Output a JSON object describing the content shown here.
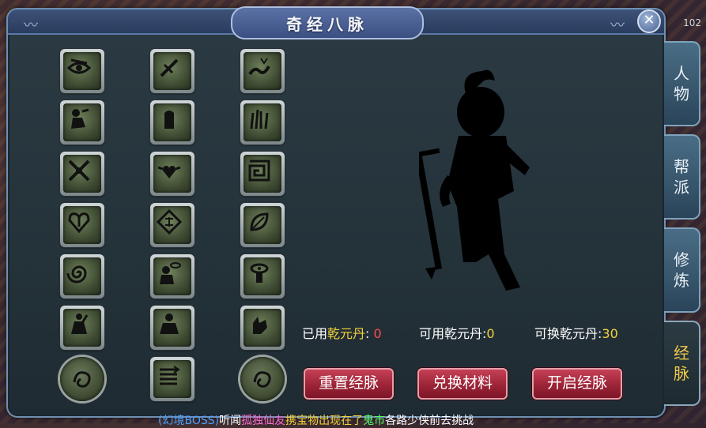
{
  "corner_number": "102",
  "window": {
    "title": "奇经八脉",
    "close_glyph": "✕"
  },
  "meridian_icons": {
    "column_1": [
      "eye-meridian",
      "figure-meridian",
      "crossed-blades-meridian",
      "heart-crest-meridian",
      "spiral-meridian",
      "warrior-meridian",
      "dragon-seal-meridian"
    ],
    "column_2": [
      "blade-strike-meridian",
      "stone-pillar-meridian",
      "winged-heart-meridian",
      "diamond-sigil-meridian",
      "speech-monk-meridian",
      "seated-sage-meridian",
      "arrow-volley-meridian"
    ],
    "column_3": [
      "wave-slash-meridian",
      "flame-grass-meridian",
      "maze-meridian",
      "leaf-drop-meridian",
      "eye-pillar-meridian",
      "hand-swirl-meridian",
      "dragon-seal-meridian"
    ]
  },
  "stats": {
    "used_label": "已用",
    "used_item": "乾元丹",
    "used_value": "0",
    "available_label": "可用乾元丹:",
    "available_value": "0",
    "exchangeable_label": "可换乾元丹:",
    "exchangeable_value": "30"
  },
  "buttons": {
    "reset": "重置经脉",
    "exchange": "兑换材料",
    "open": "开启经脉"
  },
  "side_tabs": [
    {
      "label_top": "人",
      "label_bottom": "物"
    },
    {
      "label_top": "帮",
      "label_bottom": "派"
    },
    {
      "label_top": "修",
      "label_bottom": "炼"
    },
    {
      "label_top": "经",
      "label_bottom": "脉",
      "active": true
    }
  ],
  "chat": {
    "segments": [
      "(幻境BOSS)",
      "听闻",
      "孤独仙友",
      "携宝物出现在了",
      "鬼市",
      "各路少侠前去挑战"
    ]
  },
  "colors": {
    "accent_gold": "#f3d23a",
    "button_red": "#9c2437",
    "window_border": "#6f8fb2"
  }
}
